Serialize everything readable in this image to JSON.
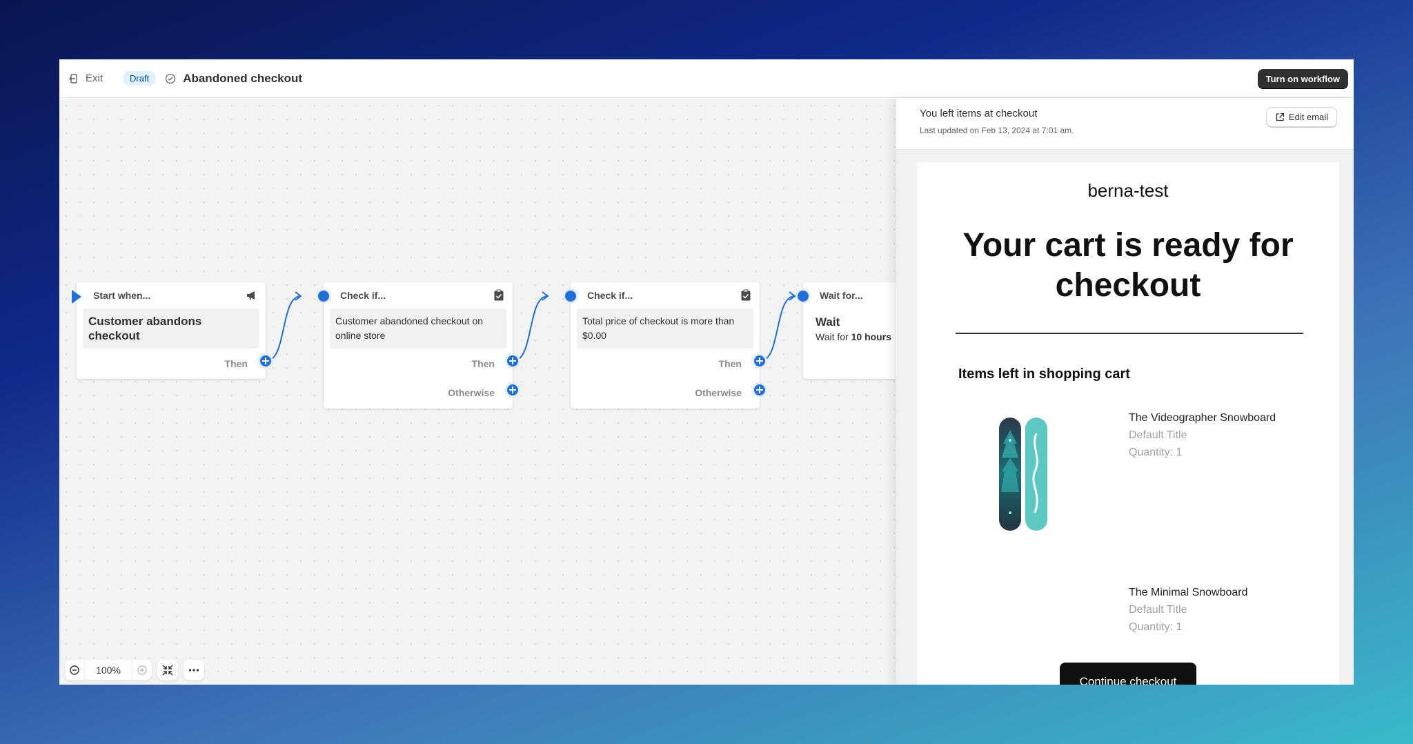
{
  "topbar": {
    "exit_label": "Exit",
    "draft_badge": "Draft",
    "workflow_title": "Abandoned checkout",
    "turn_on_label": "Turn on workflow"
  },
  "nodes": [
    {
      "header": "Start when...",
      "body": "Customer abandons checkout",
      "then_label": "Then"
    },
    {
      "header": "Check if...",
      "body": "Customer abandoned checkout on online store",
      "then_label": "Then",
      "otherwise_label": "Otherwise"
    },
    {
      "header": "Check if...",
      "body": "Total price of checkout is more than $0.00",
      "then_label": "Then",
      "otherwise_label": "Otherwise"
    },
    {
      "header": "Wait for...",
      "body_title": "Wait",
      "body_prefix": "Wait for",
      "body_strong": "10 hours"
    }
  ],
  "zoom": {
    "value": "100%"
  },
  "panel": {
    "title": "You left items at checkout",
    "subtitle": "Last updated on Feb 13, 2024 at 7:01 am.",
    "edit_label": "Edit email"
  },
  "email": {
    "shop_name": "berna-test",
    "headline": "Your cart is ready for checkout",
    "items_title": "Items left in shopping cart",
    "items": [
      {
        "name": "The Videographer Snowboard",
        "variant": "Default Title",
        "quantity": "Quantity: 1"
      },
      {
        "name": "The Minimal Snowboard",
        "variant": "Default Title",
        "quantity": "Quantity: 1"
      }
    ],
    "cta_label": "Continue checkout"
  },
  "colors": {
    "accent": "#1f6fd6",
    "primary_button": "#303030",
    "draft_bg": "#e0f0ff"
  }
}
